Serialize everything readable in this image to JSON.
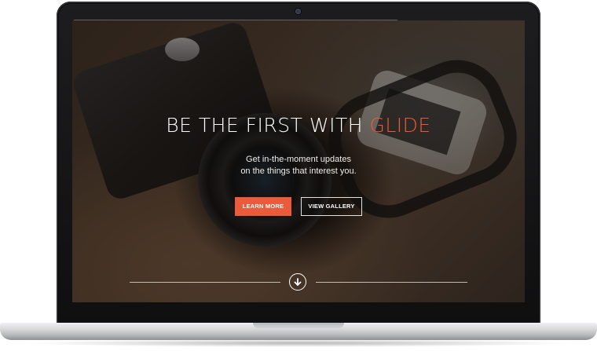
{
  "hero": {
    "title_prefix": "BE THE FIRST WITH ",
    "title_accent": "GLIDE",
    "subtitle_line1": "Get in-the-moment updates",
    "subtitle_line2": "on the things that interest you."
  },
  "buttons": {
    "learn_more": "LEARN MORE",
    "view_gallery": "VIEW GALLERY"
  },
  "icons": {
    "scroll_down": "arrow-down-circle-icon",
    "webcam": "webcam-icon"
  },
  "colors": {
    "accent": "#ea5a3b",
    "text": "#ffffff",
    "bezel": "#111112",
    "laptop_base": "#d9d9db"
  }
}
